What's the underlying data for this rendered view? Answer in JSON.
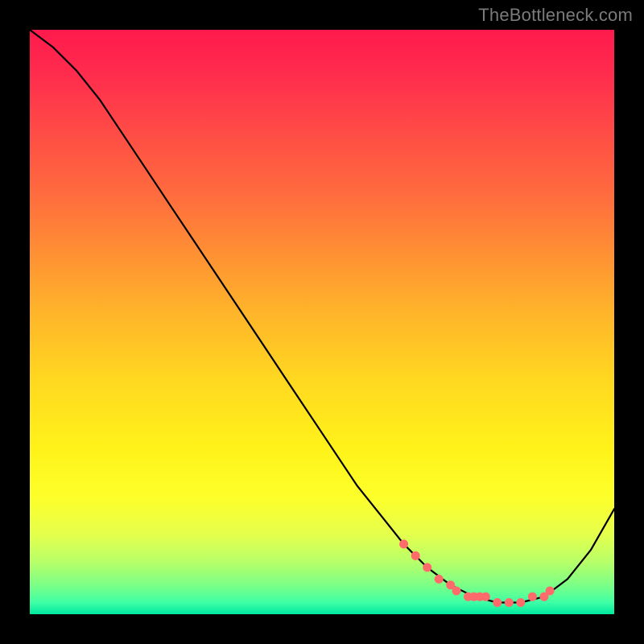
{
  "watermark": "TheBottleneck.com",
  "chart_data": {
    "type": "line",
    "title": "",
    "xlabel": "",
    "ylabel": "",
    "xlim": [
      0,
      100
    ],
    "ylim": [
      0,
      100
    ],
    "grid": false,
    "series": [
      {
        "name": "curve",
        "color": "#000000",
        "x": [
          0,
          4,
          8,
          12,
          16,
          20,
          24,
          28,
          32,
          36,
          40,
          44,
          48,
          52,
          56,
          60,
          64,
          68,
          72,
          76,
          80,
          84,
          88,
          92,
          96,
          100
        ],
        "y": [
          100,
          97,
          93,
          88,
          82,
          76,
          70,
          64,
          58,
          52,
          46,
          40,
          34,
          28,
          22,
          17,
          12,
          8,
          5,
          3,
          2,
          2,
          3,
          6,
          11,
          18
        ]
      }
    ],
    "markers": {
      "name": "dots",
      "color": "#ff6b6b",
      "x": [
        64,
        66,
        68,
        70,
        72,
        73,
        75,
        76,
        77,
        78,
        80,
        82,
        84,
        86,
        88,
        89
      ],
      "y": [
        12,
        10,
        8,
        6,
        5,
        4,
        3,
        3,
        3,
        3,
        2,
        2,
        2,
        3,
        3,
        4
      ]
    },
    "heat_gradient": {
      "top": "#ff1a4d",
      "mid": "#ffe81a",
      "bottom": "#00e8a0"
    }
  }
}
